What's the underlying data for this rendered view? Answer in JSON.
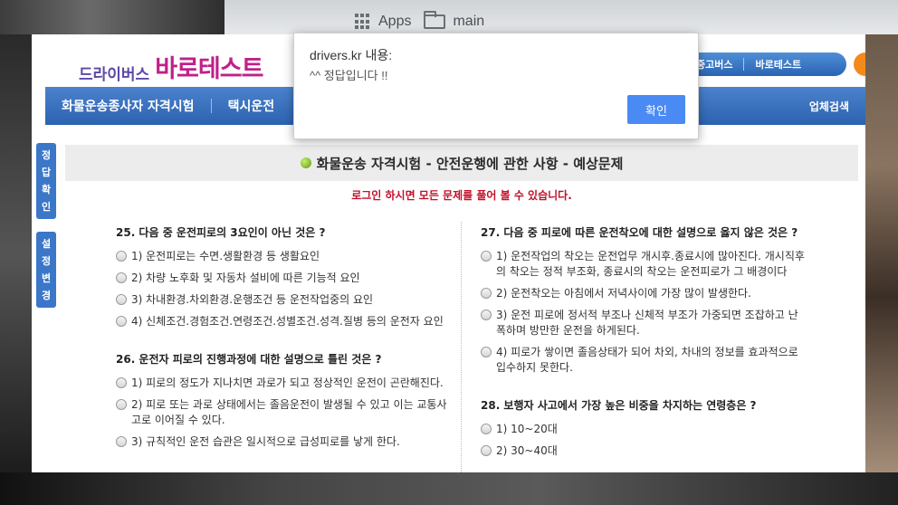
{
  "browser": {
    "bookmarks": [
      "Apps",
      "main"
    ]
  },
  "site": {
    "logo_small": "드라이버스",
    "logo_big": "바로테스트",
    "top_pills": [
      "중고버스",
      "바로테스트"
    ],
    "nav": [
      "화물운송종사자 자격시험",
      "택시운전"
    ],
    "nav_right": "업체검색",
    "side_tabs": [
      "정답확인",
      "설정변경"
    ],
    "page_title": "화물운송 자격시험 - 안전운행에 관한 사항 - 예상문제",
    "login_notice": "로그인 하시면 모든 문제를 풀어 볼 수 있습니다."
  },
  "questions_left": [
    {
      "title": "25. 다음 중 운전피로의 3요인이 아닌 것은 ?",
      "options": [
        "1) 운전피로는 수면.생활환경 등 생활요인",
        "2) 차량 노후화 및 자동차 설비에 따른 기능적 요인",
        "3) 차내환경.차외환경.운행조건 등 운전작업중의 요인",
        "4) 신체조건.경험조건.연령조건.성별조건.성격.질병 등의 운전자 요인"
      ]
    },
    {
      "title": "26. 운전자 피로의 진행과정에 대한 설명으로 틀린 것은 ?",
      "options": [
        "1) 피로의 정도가 지나치면 과로가 되고 정상적인 운전이 곤란해진다.",
        "2) 피로 또는 과로 상태에서는 졸음운전이 발생될 수 있고 이는 교통사고로 이어질 수 있다.",
        "3) 규칙적인 운전 습관은 일시적으로 급성피로를 낳게 한다."
      ]
    }
  ],
  "questions_right": [
    {
      "title": "27. 다음 중 피로에 따른 운전착오에 대한 설명으로 옳지 않은 것은 ?",
      "options": [
        "1) 운전작업의 착오는 운전업무 개시후.종료시에 많아진다. 개시직후의 착오는 정적 부조화, 종료시의 착오는 운전피로가 그 배경이다",
        "2) 운전착오는 아침에서 저녁사이에 가장 많이 발생한다.",
        "3) 운전 피로에 정서적 부조나 신체적 부조가 가중되면 조잡하고 난폭하며 방만한 운전을 하게된다.",
        "4) 피로가 쌓이면 졸음상태가 되어 차외, 차내의 정보를 효과적으로 입수하지 못한다."
      ]
    },
    {
      "title": "28. 보행자 사고에서 가장 높은 비중을 차지하는 연령층은 ?",
      "options": [
        "1) 10~20대",
        "2) 30~40대"
      ]
    }
  ],
  "dialog": {
    "title": "drivers.kr 내용:",
    "message": "^^ 정답입니다 !!",
    "ok": "확인",
    "accent": "#4a8af4"
  }
}
